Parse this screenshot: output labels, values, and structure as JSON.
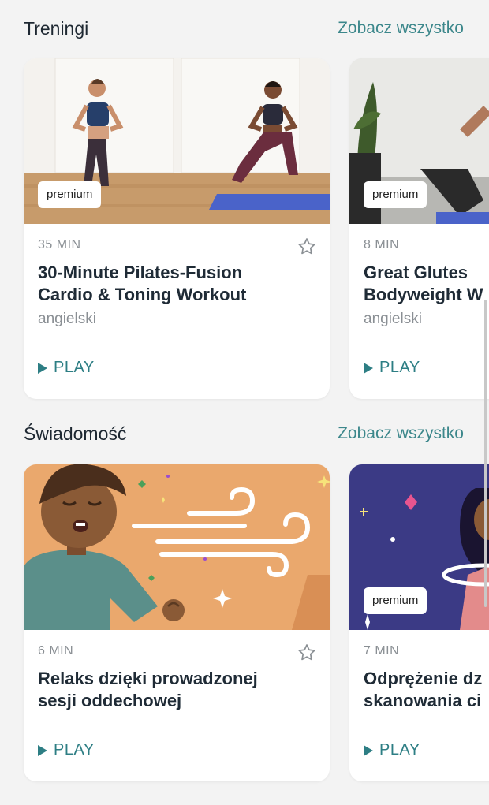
{
  "sections": [
    {
      "title": "Treningi",
      "see_all": "Zobacz wszystko",
      "cards": [
        {
          "badge": "premium",
          "duration": "35 MIN",
          "title_line1": "30-Minute Pilates-Fusion",
          "title_line2": "Cardio & Toning Workout",
          "language": "angielski",
          "play": "PLAY"
        },
        {
          "badge": "premium",
          "duration": "8 MIN",
          "title_line1": "Great Glutes",
          "title_line2": "Bodyweight W",
          "language": "angielski",
          "play": "PLAY"
        }
      ]
    },
    {
      "title": "Świadomość",
      "see_all": "Zobacz wszystko",
      "cards": [
        {
          "duration": "6 MIN",
          "title_line1": "Relaks dzięki prowadzonej",
          "title_line2": "sesji oddechowej",
          "play": "PLAY"
        },
        {
          "badge": "premium",
          "duration": "7 MIN",
          "title_line1": "Odprężenie dz",
          "title_line2": "skanowania ci",
          "play": "PLAY"
        }
      ]
    }
  ],
  "colors": {
    "accent": "#3c878b",
    "orange_bg": "#eaa86d",
    "purple_bg": "#3b3a85"
  }
}
